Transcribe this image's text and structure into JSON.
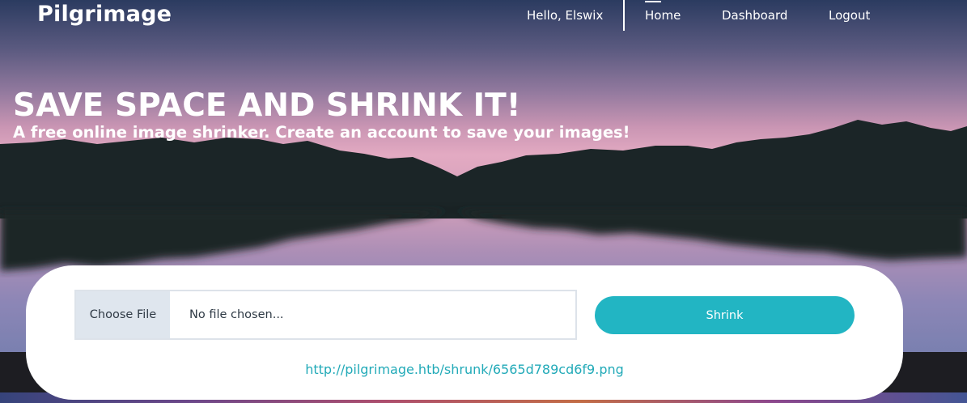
{
  "header": {
    "brand": "Pilgrimage",
    "greeting": "Hello, Elswix",
    "nav": [
      {
        "label": "Home",
        "active": true
      },
      {
        "label": "Dashboard",
        "active": false
      },
      {
        "label": "Logout",
        "active": false
      }
    ]
  },
  "hero": {
    "title": "SAVE SPACE AND SHRINK IT!",
    "subtitle": "A free online image shrinker. Create an account to save your images!"
  },
  "upload": {
    "choose_file_label": "Choose File",
    "file_status": "No file chosen...",
    "submit_label": "Shrink",
    "result_link": "http://pilgrimage.htb/shrunk/6565d789cd6f9.png"
  },
  "colors": {
    "accent": "#22b5c3",
    "link": "#22aab8",
    "mountain": "#1b2527"
  }
}
